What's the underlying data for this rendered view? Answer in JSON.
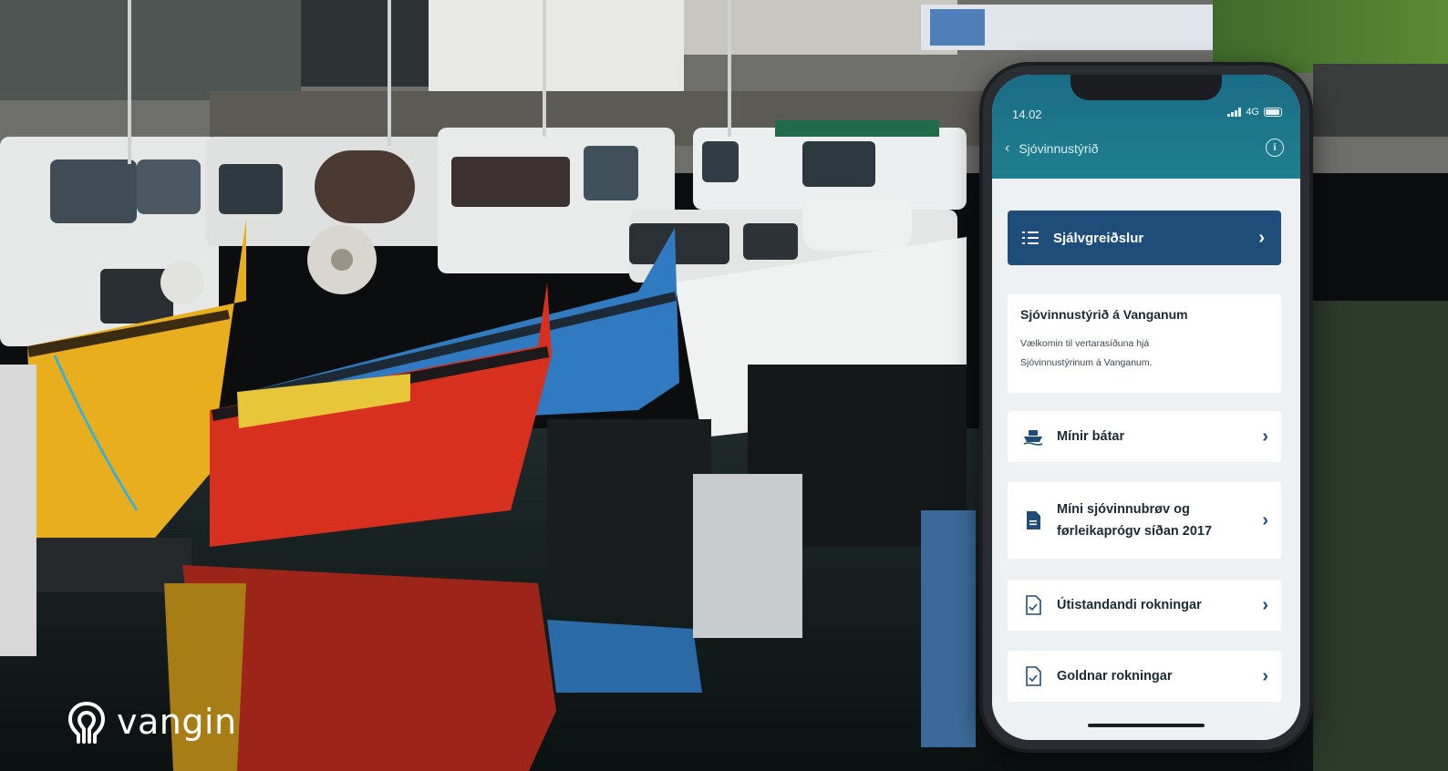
{
  "brand": {
    "name": "vangin",
    "icon": "vangin-logo-icon"
  },
  "phone": {
    "status": {
      "time": "14.02",
      "network": "4G"
    },
    "header": {
      "back_label": "Sjóvinnustýrið",
      "back_icon": "chevron-left-icon",
      "info_icon": "info-icon"
    },
    "self_service": {
      "label": "Sjálvgreiðslur",
      "icon": "list-icon"
    },
    "welcome": {
      "title": "Sjóvinnustýrið á Vanganum",
      "text": "Vælkomin til vertarasíðuna hjá Sjóvinnustýrinum á Vanganum."
    },
    "menu": [
      {
        "label": "Mínir bátar",
        "icon": "boat-icon"
      },
      {
        "label": "Míni sjóvinnubrøv og førleikaprógv síðan 2017",
        "icon": "document-icon"
      },
      {
        "label": "Útistandandi rokningar",
        "icon": "invoice-icon"
      },
      {
        "label": "Goldnar rokningar",
        "icon": "invoice-icon"
      }
    ]
  },
  "colors": {
    "header_teal": "#1a6c86",
    "primary_blue": "#1f4d7a",
    "background": "#eef1f3"
  }
}
